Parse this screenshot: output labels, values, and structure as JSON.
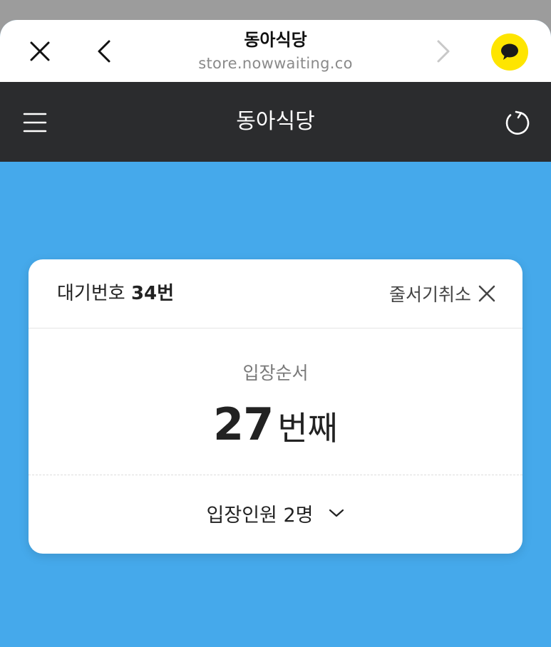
{
  "browser": {
    "page_title": "동아식당",
    "host": "store.nowwaiting.co",
    "icons": {
      "close": "close-icon",
      "back": "chevron-left-icon",
      "forward": "chevron-right-icon",
      "chat": "kakao-chat-icon"
    }
  },
  "header": {
    "title": "동아식당",
    "icons": {
      "menu": "hamburger-menu-icon",
      "refresh": "refresh-icon"
    }
  },
  "card": {
    "wait_label": "대기번호",
    "wait_number": "34번",
    "cancel_label": "줄서기취소",
    "order_label": "입장순서",
    "order_number": "27",
    "order_unit": "번째",
    "party_label": "입장인원 2명"
  },
  "colors": {
    "background": "#45a9eb",
    "header_bg": "#2b2c2e",
    "kakao_yellow": "#fee500"
  }
}
